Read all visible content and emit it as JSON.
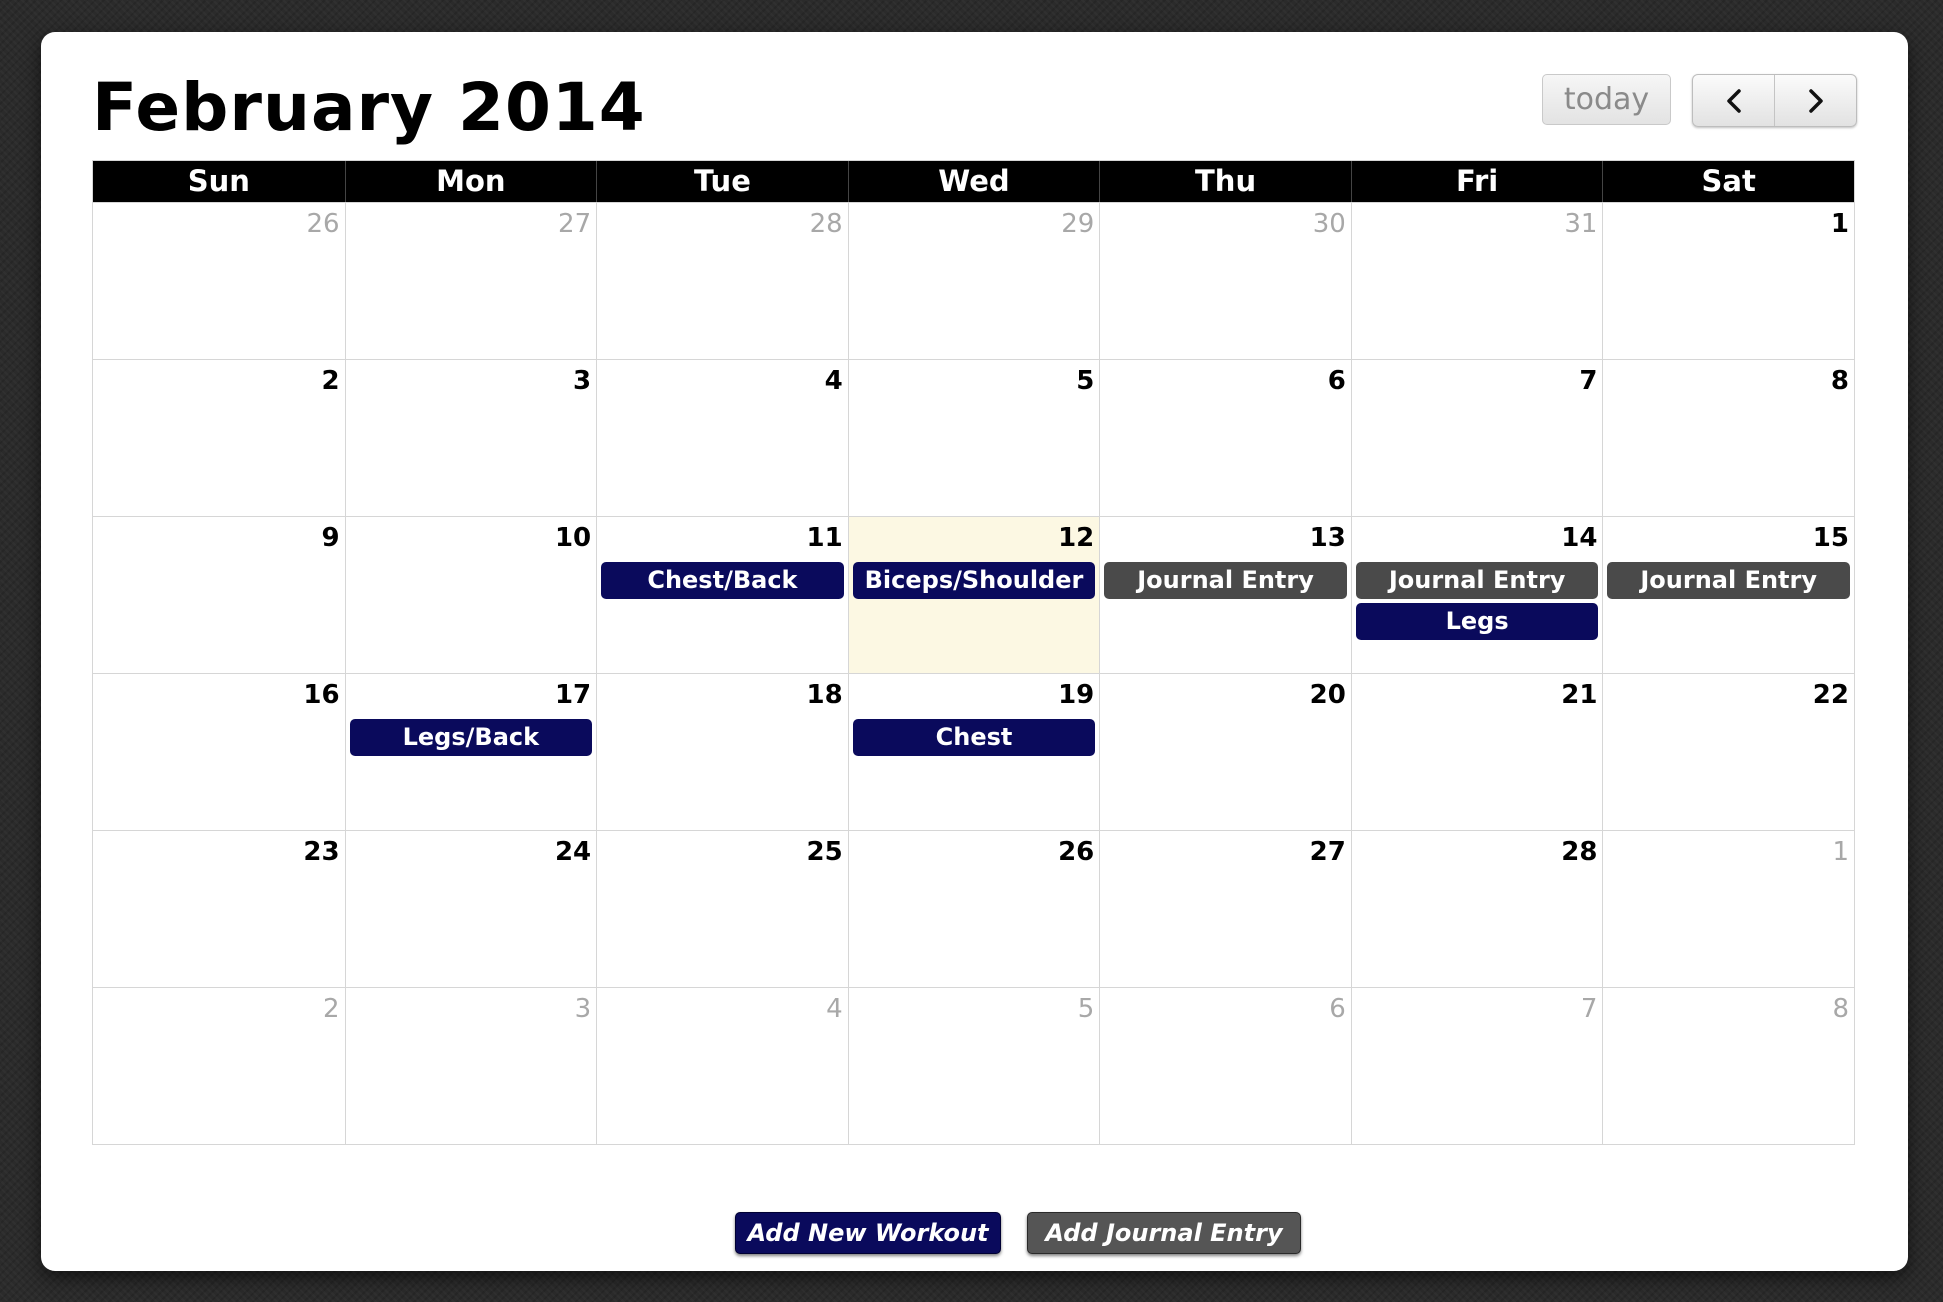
{
  "calendar": {
    "title": "February 2014",
    "today_label": "today",
    "prev_icon": "chevron-left-icon",
    "next_icon": "chevron-right-icon",
    "weekdays": [
      "Sun",
      "Mon",
      "Tue",
      "Wed",
      "Thu",
      "Fri",
      "Sat"
    ],
    "weeks": [
      [
        {
          "day": "26",
          "other": true,
          "events": []
        },
        {
          "day": "27",
          "other": true,
          "events": []
        },
        {
          "day": "28",
          "other": true,
          "events": []
        },
        {
          "day": "29",
          "other": true,
          "events": []
        },
        {
          "day": "30",
          "other": true,
          "events": []
        },
        {
          "day": "31",
          "other": true,
          "events": []
        },
        {
          "day": "1",
          "other": false,
          "events": []
        }
      ],
      [
        {
          "day": "2",
          "other": false,
          "events": []
        },
        {
          "day": "3",
          "other": false,
          "events": []
        },
        {
          "day": "4",
          "other": false,
          "events": []
        },
        {
          "day": "5",
          "other": false,
          "events": []
        },
        {
          "day": "6",
          "other": false,
          "events": []
        },
        {
          "day": "7",
          "other": false,
          "events": []
        },
        {
          "day": "8",
          "other": false,
          "events": []
        }
      ],
      [
        {
          "day": "9",
          "other": false,
          "events": []
        },
        {
          "day": "10",
          "other": false,
          "events": []
        },
        {
          "day": "11",
          "other": false,
          "events": [
            {
              "title": "Chest/Back",
              "kind": "workout"
            }
          ]
        },
        {
          "day": "12",
          "other": false,
          "today": true,
          "events": [
            {
              "title": "Biceps/Shoulder",
              "kind": "workout"
            }
          ]
        },
        {
          "day": "13",
          "other": false,
          "events": [
            {
              "title": "Journal Entry",
              "kind": "journal"
            }
          ]
        },
        {
          "day": "14",
          "other": false,
          "events": [
            {
              "title": "Journal Entry",
              "kind": "journal"
            },
            {
              "title": "Legs",
              "kind": "workout"
            }
          ]
        },
        {
          "day": "15",
          "other": false,
          "events": [
            {
              "title": "Journal Entry",
              "kind": "journal"
            }
          ]
        }
      ],
      [
        {
          "day": "16",
          "other": false,
          "events": []
        },
        {
          "day": "17",
          "other": false,
          "events": [
            {
              "title": "Legs/Back",
              "kind": "workout"
            }
          ]
        },
        {
          "day": "18",
          "other": false,
          "events": []
        },
        {
          "day": "19",
          "other": false,
          "events": [
            {
              "title": "Chest",
              "kind": "workout"
            }
          ]
        },
        {
          "day": "20",
          "other": false,
          "events": []
        },
        {
          "day": "21",
          "other": false,
          "events": []
        },
        {
          "day": "22",
          "other": false,
          "events": []
        }
      ],
      [
        {
          "day": "23",
          "other": false,
          "events": []
        },
        {
          "day": "24",
          "other": false,
          "events": []
        },
        {
          "day": "25",
          "other": false,
          "events": []
        },
        {
          "day": "26",
          "other": false,
          "events": []
        },
        {
          "day": "27",
          "other": false,
          "events": []
        },
        {
          "day": "28",
          "other": false,
          "events": []
        },
        {
          "day": "1",
          "other": true,
          "events": []
        }
      ],
      [
        {
          "day": "2",
          "other": true,
          "events": []
        },
        {
          "day": "3",
          "other": true,
          "events": []
        },
        {
          "day": "4",
          "other": true,
          "events": []
        },
        {
          "day": "5",
          "other": true,
          "events": []
        },
        {
          "day": "6",
          "other": true,
          "events": []
        },
        {
          "day": "7",
          "other": true,
          "events": []
        },
        {
          "day": "8",
          "other": true,
          "events": []
        }
      ]
    ]
  },
  "actions": {
    "add_workout_label": "Add New Workout",
    "add_journal_label": "Add Journal Entry"
  },
  "colors": {
    "workout": "#0a0a5c",
    "journal": "#4a4a4a",
    "today_highlight": "#fcf8e3",
    "header_bg": "#000000"
  }
}
